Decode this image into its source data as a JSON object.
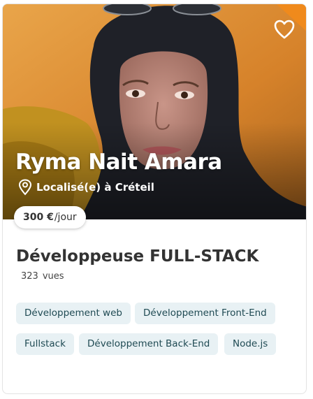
{
  "profile": {
    "name": "Ryma Nait Amara",
    "location": "Localisé(e) à Créteil",
    "price_amount": "300 €",
    "price_unit": "/jour",
    "title": "Développeuse FULL-STACK",
    "views_count": "323",
    "views_label": "vues"
  },
  "tags": [
    "Développement web",
    "Développement Front-End",
    "Fullstack",
    "Développement Back-End",
    "Node.js"
  ],
  "icons": {
    "favorite": "heart-icon",
    "location": "map-pin-icon"
  },
  "colors": {
    "tag_bg": "#e8f1f4",
    "tag_text": "#1f4a53",
    "photo_orange": "#d9892f"
  }
}
